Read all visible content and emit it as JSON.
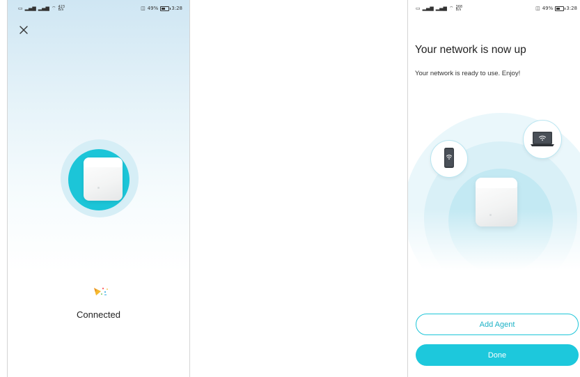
{
  "status_bar": {
    "left_icons": [
      "sim-icon",
      "signal-icon",
      "signal-icon",
      "wifi-icon"
    ],
    "speed_left": "423",
    "speed_right": "368",
    "speed_unit": "B/s",
    "battery": "49%",
    "time": "3:28"
  },
  "left_screen": {
    "close_icon": "close-icon",
    "status_text": "Connected"
  },
  "right_screen": {
    "title": "Your network is now up",
    "subtitle": "Your network is ready to use. Enjoy!",
    "add_agent_label": "Add Agent",
    "done_label": "Done"
  },
  "colors": {
    "accent": "#1dc8dc",
    "accent_text": "#1cb2c6",
    "text": "#222222"
  }
}
